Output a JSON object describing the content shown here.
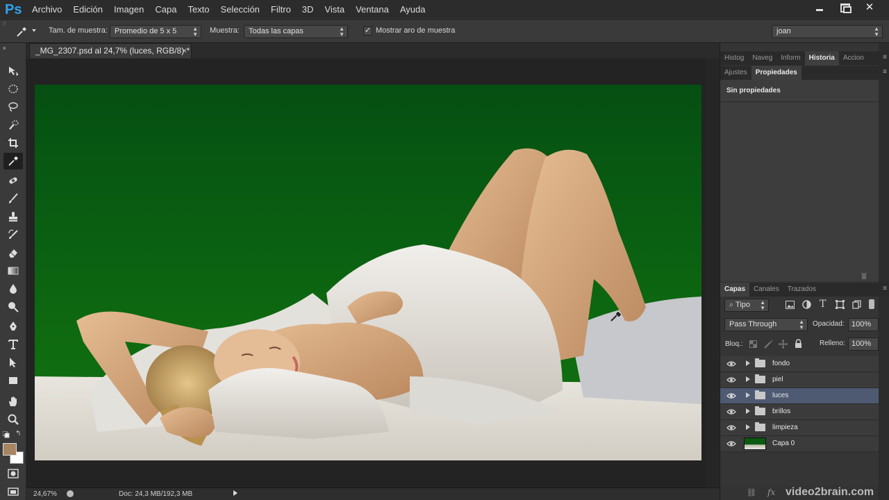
{
  "app": {
    "logo": "Ps",
    "menu": [
      "Archivo",
      "Edición",
      "Imagen",
      "Capa",
      "Texto",
      "Selección",
      "Filtro",
      "3D",
      "Vista",
      "Ventana",
      "Ayuda"
    ],
    "window_close": "✕"
  },
  "options": {
    "sample_size_label": "Tam. de muestra:",
    "sample_size_value": "Promedio de 5 x 5",
    "sample_label": "Muestra:",
    "sample_value": "Todas las capas",
    "show_ring_label": "Mostrar aro de muestra",
    "show_ring_checked": true,
    "workspace_value": "joan"
  },
  "document": {
    "tab_title": "_MG_2307.psd al 24,7% (luces, RGB/8) *",
    "close": "×"
  },
  "status": {
    "zoom": "24,67%",
    "doc_info": "Doc: 24,3 MB/192,3 MB"
  },
  "panels": {
    "top_tabs": [
      "Histog",
      "Naveg",
      "Inform",
      "Historia",
      "Accion"
    ],
    "top_active": "Historia",
    "mid_tabs": [
      "Ajustes",
      "Propiedades"
    ],
    "mid_active": "Propiedades",
    "properties_text": "Sin propiedades",
    "layers_tabs": [
      "Capas",
      "Canales",
      "Trazados"
    ],
    "layers_active": "Capas",
    "filter_label": "Tipo",
    "blend_mode": "Pass Through",
    "opacity_label": "Opacidad:",
    "opacity_value": "100%",
    "lock_label": "Bloq.:",
    "fill_label": "Relleno:",
    "fill_value": "100%"
  },
  "layers": [
    {
      "name": "fondo",
      "type": "group",
      "selected": false
    },
    {
      "name": "piel",
      "type": "group",
      "selected": false
    },
    {
      "name": "luces",
      "type": "group",
      "selected": true
    },
    {
      "name": "brillos",
      "type": "group",
      "selected": false
    },
    {
      "name": "limpieza",
      "type": "group",
      "selected": false
    },
    {
      "name": "Capa 0",
      "type": "pixel",
      "selected": false
    }
  ],
  "watermark": "video2brain.com",
  "colors": {
    "foreground": "#a88462",
    "background": "#ffffff",
    "canvas_bg_top": "#054f12",
    "selected_layer": "#4e5a72"
  }
}
